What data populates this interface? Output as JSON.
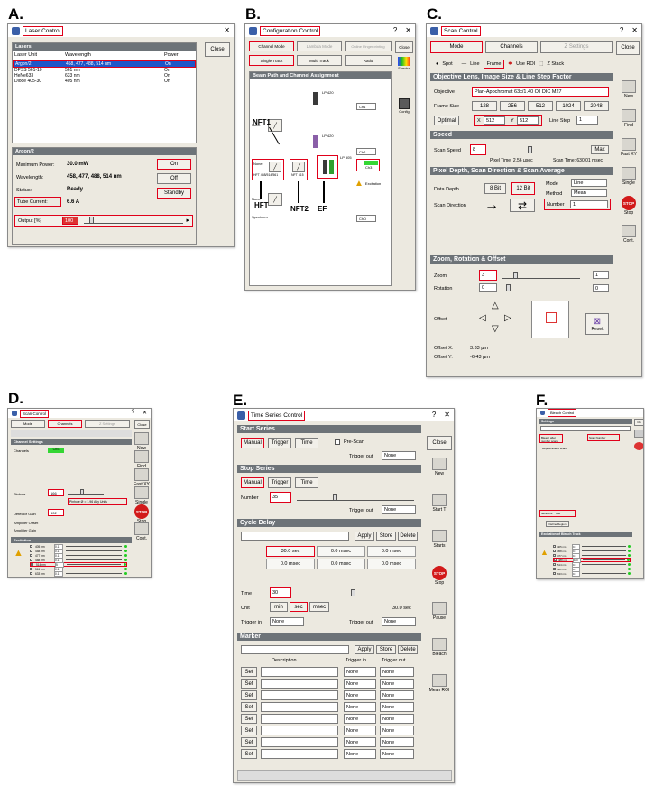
{
  "panels": {
    "a": {
      "letter": "A.",
      "title": "Laser Control",
      "close": "Close",
      "lasers_header": "Lasers",
      "cols": [
        "Laser Unit",
        "Wavelength",
        "Power"
      ],
      "rows": [
        [
          "Argon/2",
          "458, 477, 488, 514 nm",
          "On"
        ],
        [
          "DPSS 561-10",
          "561 nm",
          "On"
        ],
        [
          "HeNe633",
          "633 nm",
          "On"
        ],
        [
          "Diode 405-30",
          "405 nm",
          "On"
        ]
      ],
      "argon_header": "Argon/2",
      "max_power_label": "Maximum Power:",
      "max_power": "30.0 mW",
      "wavelength_label": "Wavelength:",
      "wavelength": "458, 477, 488, 514 nm",
      "status_label": "Status:",
      "status": "Ready",
      "tube_label": "Tube Current:",
      "tube": "6.6 A",
      "output_label": "Output [%]",
      "output_value": "100",
      "on_btn": "On",
      "off_btn": "Off",
      "standby_btn": "Standby"
    },
    "b": {
      "letter": "B.",
      "title": "Configuration Control",
      "tabs": [
        "Channel Mode",
        "Lambda Mode",
        "Online Fingerprinting"
      ],
      "modes": [
        "Single Track",
        "Multi Track",
        "Ratio"
      ],
      "close": "Close",
      "spectra": "Spectra",
      "config": "Config",
      "beam_header": "Beam Path and Channel Assignment",
      "lp_labels": [
        "LP 420",
        "LP 420",
        "LP 505",
        "LP 530"
      ],
      "ch_labels": [
        "Ch1",
        "Ch2",
        "Ch3",
        "ChD"
      ],
      "none": "None",
      "hft_box": "HFT 458/514/561",
      "nft_box": "NFT 515",
      "excitation": "Excitation",
      "specimen": "Specimen",
      "arrow_nft1": "NFT1",
      "arrow_hft": "HFT",
      "arrow_nft2": "NFT2",
      "arrow_ef": "EF"
    },
    "c": {
      "letter": "C.",
      "title": "Scan Control",
      "tabs": [
        "Mode",
        "Channels",
        "Z Settings"
      ],
      "scan_modes": [
        "Spot",
        "Line",
        "Frame",
        "Use ROI",
        "Z Stack"
      ],
      "close": "Close",
      "obj_header": "Objective Lens, Image Size & Line Step Factor",
      "objective_label": "Objective",
      "objective": "Plan-Apochromat 63x/1.40 Oil DIC M27",
      "frame_label": "Frame Size",
      "frame_sizes": [
        "128",
        "256",
        "512",
        "1024",
        "2048"
      ],
      "optimal": "Optimal",
      "x_label": "X",
      "x_value": "512",
      "y_label": "Y",
      "y_value": "512",
      "line_step_label": "Line Step",
      "line_step": "1",
      "speed_header": "Speed",
      "scan_speed_label": "Scan Speed",
      "scan_speed": "8",
      "max_btn": "Max",
      "pixel_time": "Pixel Time: 2.56 µsec",
      "scan_time": "Scan Time: 630.01 msec",
      "depth_header": "Pixel Depth, Scan Direction & Scan Average",
      "data_depth_label": "Data Depth",
      "depth_8": "8 Bit",
      "depth_12": "12 Bit",
      "scan_dir_label": "Scan Direction",
      "mode_label": "Mode",
      "mode_value": "Line",
      "method_label": "Method",
      "method_value": "Mean",
      "number_label": "Number",
      "number_value": "1",
      "zoom_header": "Zoom, Rotation & Offset",
      "zoom_label": "Zoom",
      "zoom_value": "3",
      "rotation_label": "Rotation",
      "rotation_value": "0",
      "offset_label": "Offset",
      "offset_x_label": "Offset X:",
      "offset_x": "3.33 µm",
      "offset_y_label": "Offset Y:",
      "offset_y": "-6.43 µm",
      "reset": "Reset",
      "sidebar": [
        "New",
        "Find",
        "Fast XY",
        "Single",
        "Stop",
        "Cont."
      ],
      "stop_word": "STOP"
    },
    "d": {
      "letter": "D.",
      "title": "Scan Control",
      "tabs": [
        "Mode",
        "Channels",
        "Z Settings"
      ],
      "settings_header": "Channel Settings",
      "channels_label": "Channels",
      "channel_chip": "ChS",
      "pinhole_label": "Pinhole",
      "pinhole_value": "166",
      "pinhole_info": "Pinhole Ø = 1.96 Airy Units",
      "detector_gain_label": "Detector Gain",
      "detector_gain": "502",
      "offset_label": "Amplifier Offset",
      "amp_gain_label": "Amplifier Gain",
      "excitation_header": "Excitation",
      "lines": [
        "405 nm",
        "458 nm",
        "477 nm",
        "488 nm",
        "514 nm",
        "561 nm",
        "633 nm"
      ],
      "line_values": [
        "0.1",
        "0.1",
        "0.1",
        "0.1",
        "5",
        "0.1",
        "0.1"
      ],
      "sidebar": [
        "New",
        "Find",
        "Fast XY",
        "Single",
        "Stop",
        "Cont."
      ],
      "close": "Close",
      "stop_word": "STOP"
    },
    "e": {
      "letter": "E.",
      "title": "Time Series Control",
      "start_header": "Start Series",
      "start_buttons": [
        "Manual",
        "Trigger",
        "Time"
      ],
      "prescan": "Pre-Scan",
      "trigger_out": "Trigger out",
      "none": "None",
      "stop_header": "Stop Series",
      "stop_buttons": [
        "Manual",
        "Trigger",
        "Time"
      ],
      "number_label": "Number",
      "number_value": "35",
      "cycle_header": "Cycle Delay",
      "apply": "Apply",
      "store": "Store",
      "delete": "Delete",
      "delays": [
        "30.0 sec",
        "0.0 msec",
        "0.0 msec",
        "0.0 msec",
        "0.0 msec",
        "0.0 msec"
      ],
      "time_label": "Time",
      "time_value": "30",
      "unit_label": "Unit",
      "units": [
        "min",
        "sec",
        "msec"
      ],
      "time_display": "30.0 sec",
      "trigger_in": "Trigger in",
      "marker_header": "Marker",
      "desc_col": "Description",
      "trigger_in_col": "Trigger in",
      "trigger_out_col": "Trigger out",
      "set": "Set",
      "close": "Close",
      "sidebar": [
        "New",
        "Start T",
        "Starts",
        "Stop",
        "Pause",
        "Bleach",
        "Mean ROI"
      ],
      "stop_word": "STOP"
    },
    "f": {
      "letter": "F.",
      "title": "Bleach Control",
      "settings_header": "Settings",
      "start_after": "Bleach after number scans",
      "scan_number": "Scan Number",
      "repeat": "Repeat after # scans",
      "iterations_label": "Iterations",
      "iterations": "200",
      "define_region": "Define Region",
      "excitation_header": "Excitation of Bleach Track",
      "lines": [
        "405 nm",
        "458 nm",
        "477 nm",
        "488 nm",
        "514 nm",
        "561 nm",
        "633 nm"
      ],
      "line_values": [
        "0.1",
        "0.1",
        "0.1",
        "100",
        "0.1",
        "0.1",
        "0.1"
      ]
    }
  }
}
